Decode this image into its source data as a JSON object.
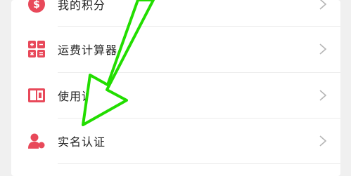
{
  "menu": {
    "items": [
      {
        "label": "我的积分",
        "icon": "points-icon"
      },
      {
        "label": "运费计算器",
        "icon": "calculator-icon"
      },
      {
        "label": "使用说明",
        "icon": "manual-book-icon"
      },
      {
        "label": "实名认证",
        "icon": "person-verify-icon"
      }
    ]
  },
  "colors": {
    "accent": "#e8495a",
    "annotation_arrow": "#22dd00"
  }
}
